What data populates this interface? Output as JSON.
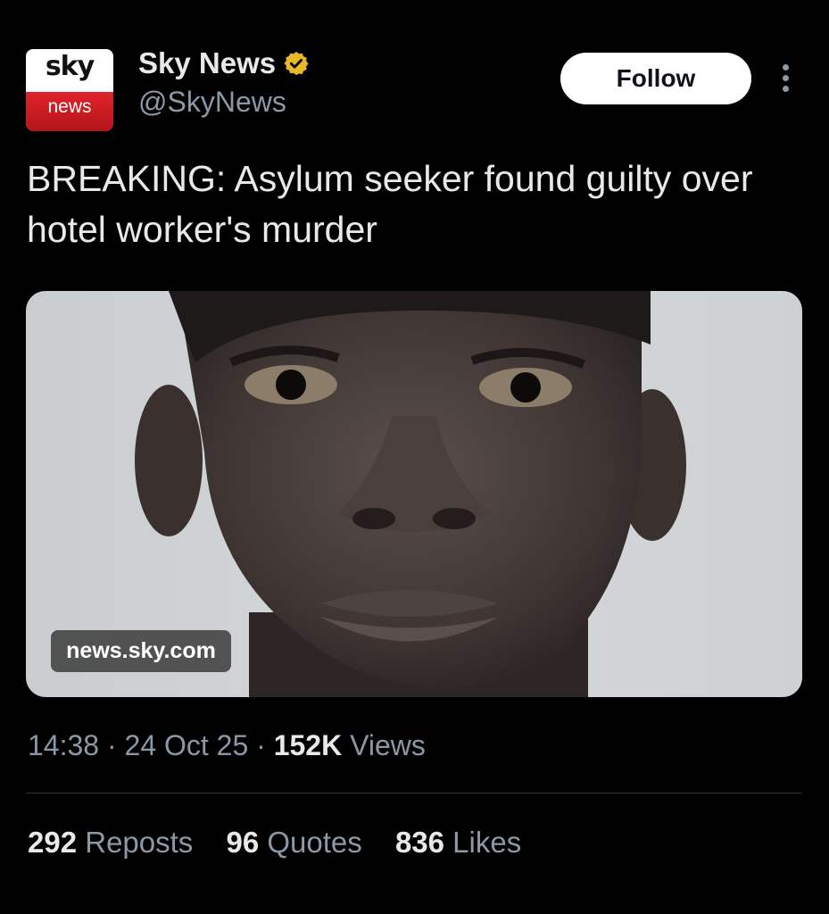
{
  "account": {
    "avatar_top_text": "sky",
    "avatar_bottom_text": "news",
    "display_name": "Sky News",
    "handle": "@SkyNews",
    "verified_icon": "verified-badge-icon",
    "verified_color": "#e8b829"
  },
  "actions": {
    "follow_label": "Follow",
    "more_icon": "more-vertical-icon"
  },
  "tweet": {
    "text": "BREAKING: Asylum seeker found guilty over hotel worker's murder",
    "link_card_domain": "news.sky.com",
    "media_description_icon": "photo"
  },
  "meta": {
    "time": "14:38",
    "separator1": " · ",
    "date": "24 Oct 25",
    "separator2": " · ",
    "views_count": "152K",
    "views_label": " Views"
  },
  "stats": [
    {
      "count": "292",
      "label": " Reposts"
    },
    {
      "count": "96",
      "label": " Quotes"
    },
    {
      "count": "836",
      "label": " Likes"
    }
  ],
  "colors": {
    "background": "#000000",
    "primary_text": "#e7e9ea",
    "secondary_text": "#8b98a5",
    "sky_red": "#e0232b"
  }
}
